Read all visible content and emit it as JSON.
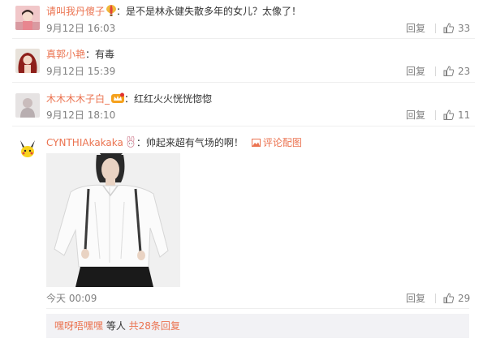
{
  "comments": [
    {
      "username": "请叫我丹傻子",
      "badge": "hot-air-balloon-icon",
      "separator": "：",
      "text": "是不是林永健失散多年的女儿？太像了！",
      "time": "9月12日 16:03",
      "reply_label": "回复",
      "likes": "33"
    },
    {
      "username": "真郭小艳",
      "separator": "：",
      "text": "有毒",
      "time": "9月12日 15:39",
      "reply_label": "回复",
      "likes": "23"
    },
    {
      "username": "木木木木子白_",
      "badge": "vip-crown-icon",
      "separator": "：",
      "text": "红红火火恍恍惚惚",
      "time": "9月12日 18:10",
      "reply_label": "回复",
      "likes": "11"
    },
    {
      "username": "CYNTHIAkakaka",
      "badge": "rabbit-icon",
      "separator": "：",
      "text": "帅起来超有气场的啊！",
      "pic_link_label": "评论配图",
      "time": "今天 00:09",
      "reply_label": "回复",
      "likes": "29"
    }
  ],
  "more_replies": {
    "user": "嘿呀唔嘿嘿",
    "middle": " 等人 ",
    "count_text": "共28条回复"
  },
  "colors": {
    "accent": "#eb7350",
    "meta": "#808080",
    "text": "#333333",
    "reply_box_bg": "#f2f2f5"
  }
}
